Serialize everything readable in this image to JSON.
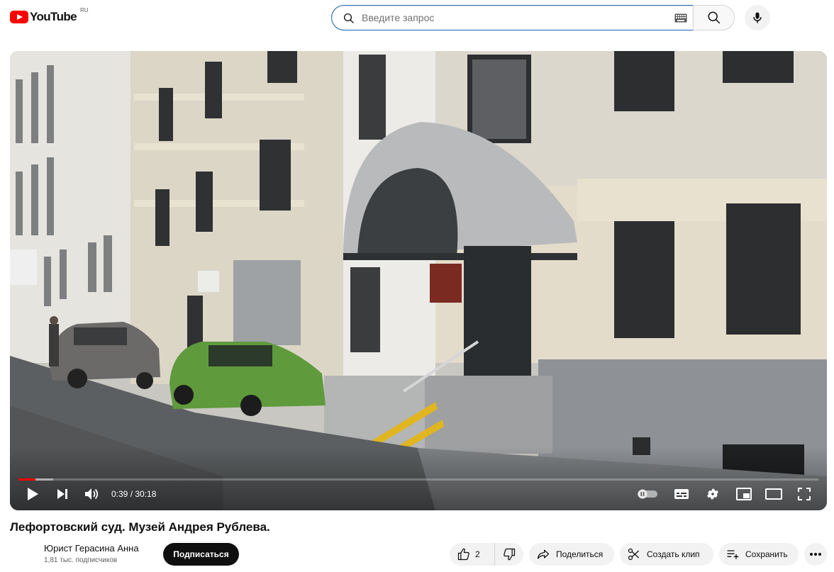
{
  "masthead": {
    "logo_text": "YouTube",
    "country_code": "RU",
    "search": {
      "placeholder": "Введите запрос",
      "value": ""
    }
  },
  "player": {
    "current_time": "0:39",
    "duration": "30:18",
    "time_display": "0:39 / 30:18",
    "progress_fraction": 0.021,
    "buffered_fraction": 0.043,
    "autoplay_on": false
  },
  "video": {
    "title": "Лефортовский суд. Музей Андрея Рублева.",
    "channel_name": "Юрист Герасина Анна",
    "subscriber_count": "1,81 тыс. подписчиков",
    "subscribe_label": "Подписаться"
  },
  "actions": {
    "like_count": "2",
    "share_label": "Поделиться",
    "clip_label": "Создать клип",
    "save_label": "Сохранить"
  },
  "icons": {
    "search": "search-icon",
    "keyboard": "keyboard-icon",
    "mic": "microphone-icon",
    "play": "play-icon",
    "next": "next-icon",
    "volume": "volume-icon",
    "autoplay": "autoplay-toggle-icon",
    "subtitles": "subtitles-icon",
    "settings": "gear-icon",
    "miniplayer": "miniplayer-icon",
    "theater": "theater-mode-icon",
    "fullscreen": "fullscreen-icon",
    "like": "thumbs-up-icon",
    "dislike": "thumbs-down-icon",
    "share": "share-icon",
    "clip": "scissors-icon",
    "save": "playlist-add-icon",
    "more": "more-icon"
  },
  "colors": {
    "brand_red": "#ff0000",
    "search_focus_border": "#1c62b9",
    "subscribe_bg": "#0f0f0f",
    "pill_bg": "#f2f2f2"
  }
}
